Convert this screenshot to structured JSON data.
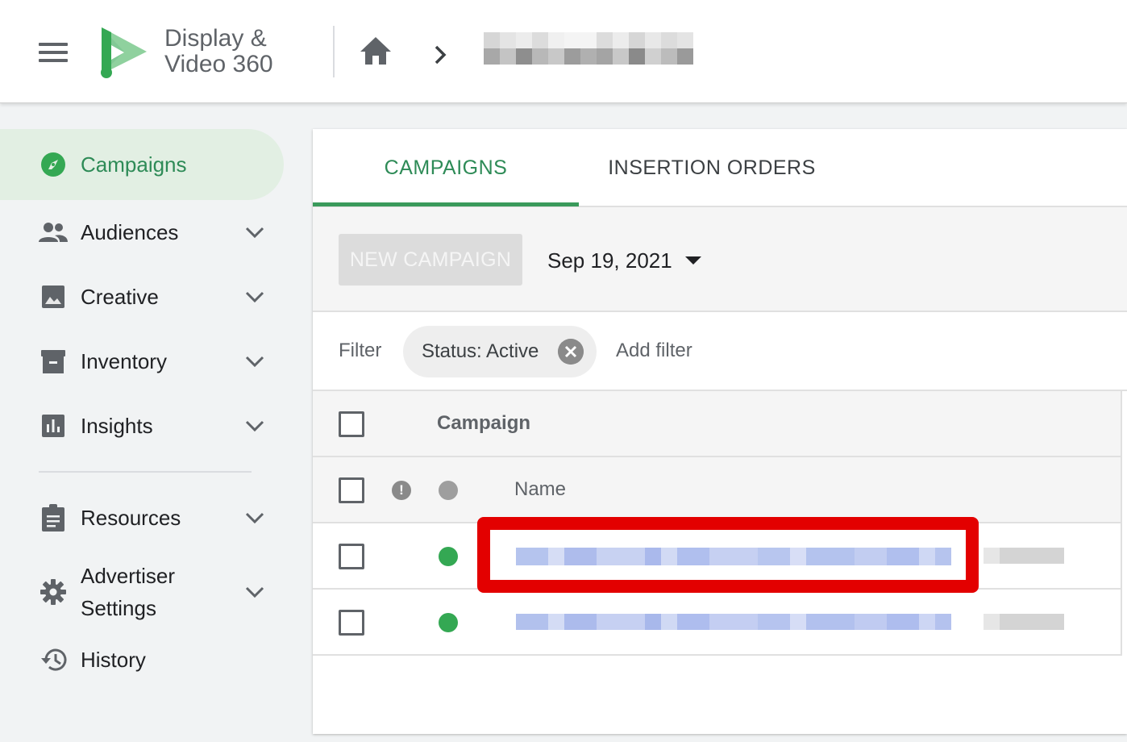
{
  "header": {
    "product_name": "Display &\nVideo 360",
    "breadcrumb_text": ""
  },
  "sidebar": {
    "items": [
      {
        "label": "Campaigns",
        "icon": "compass-icon",
        "active": true
      },
      {
        "label": "Audiences",
        "icon": "people-icon"
      },
      {
        "label": "Creative",
        "icon": "image-icon"
      },
      {
        "label": "Inventory",
        "icon": "archive-icon"
      },
      {
        "label": "Insights",
        "icon": "bar-chart-icon"
      },
      {
        "label": "Resources",
        "icon": "clipboard-icon"
      },
      {
        "label": "Advertiser\nSettings",
        "icon": "gear-icon"
      },
      {
        "label": "History",
        "icon": "history-icon"
      }
    ]
  },
  "tabs": [
    {
      "label": "CAMPAIGNS",
      "active": true
    },
    {
      "label": "INSERTION ORDERS",
      "active": false
    }
  ],
  "toolbar": {
    "new_campaign_label": "NEW CAMPAIGN",
    "date_label": "Sep 19, 2021"
  },
  "filters": {
    "label": "Filter",
    "chip_text": "Status: Active",
    "add_filter_label": "Add filter"
  },
  "table": {
    "group_header": "Campaign",
    "name_header": "Name",
    "alert_glyph": "!",
    "rows": [
      {
        "status": "active",
        "highlighted": true
      },
      {
        "status": "active",
        "highlighted": false
      }
    ]
  },
  "colors": {
    "accent_green": "#2e8b57",
    "active_status": "#34a853",
    "highlight_red": "#e30000",
    "link_blue_redacted": "#aebff0"
  }
}
